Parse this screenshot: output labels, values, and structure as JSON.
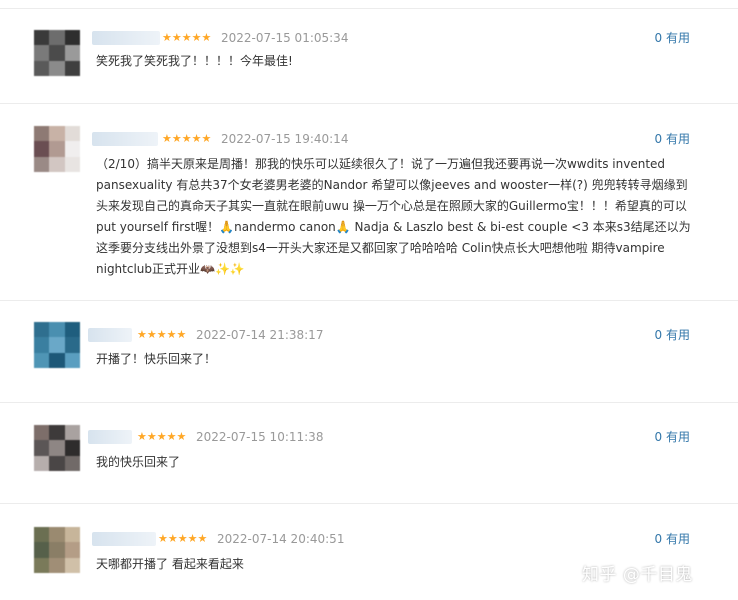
{
  "reviews": [
    {
      "stars": "★★★★★",
      "time": "2022-07-15 01:05:34",
      "useful": "0 有用",
      "text": "笑死我了笑死我了！！！！今年最佳!",
      "avatar": [
        "#3a3a3a",
        "#6d6d6d",
        "#2e2e2e",
        "#7a7a7a",
        "#4b4b4b",
        "#9a9a9a",
        "#5a5a5a",
        "#8b8b8b",
        "#3f3f3f"
      ]
    },
    {
      "stars": "★★★★★",
      "time": "2022-07-15 19:40:14",
      "useful": "0 有用",
      "text": "（2/10）搞半天原来是周播！那我的快乐可以延续很久了！说了一万遍但我还要再说一次wwdits invented pansexuality 有总共37个女老婆男老婆的Nandor 希望可以像jeeves and wooster一样(?) 兜兜转转寻烟缘到头来发现自己的真命天子其实一直就在眼前uwu 操一万个心总是在照顾大家的Guillermo宝！！！希望真的可以put yourself first喔！🙏nandermo canon🙏 Nadja & Laszlo best & bi-est couple <3 本来s3结尾还以为这季要分支线出外景了没想到s4一开头大家还是又都回家了哈哈哈哈 Colin快点长大吧想他啦 期待vampire nightclub正式开业🦇✨✨",
      "avatar": [
        "#8e7a74",
        "#c8b2a6",
        "#e2dcd8",
        "#6a4e52",
        "#b19a92",
        "#f0eeee",
        "#9a8a86",
        "#d2c6c2",
        "#e8e4e2"
      ]
    },
    {
      "stars": "★★★★★",
      "time": "2022-07-14 21:38:17",
      "useful": "0 有用",
      "text": "开播了！快乐回来了！",
      "avatar": [
        "#2f6f8f",
        "#4a8fb0",
        "#1f5e7e",
        "#3a7fa0",
        "#6aa8c8",
        "#2a6a8a",
        "#4f95b5",
        "#1d5878",
        "#5a9ec0"
      ]
    },
    {
      "stars": "★★★★★",
      "time": "2022-07-15 10:11:38",
      "useful": "0 有用",
      "text": "我的快乐回来了",
      "avatar": [
        "#7d6e6a",
        "#3d3a3a",
        "#a9a2a0",
        "#5b5656",
        "#8e8684",
        "#2e2c2c",
        "#b6aeac",
        "#4a4646",
        "#716a68"
      ]
    },
    {
      "stars": "★★★★★",
      "time": "2022-07-14 20:40:51",
      "useful": "0 有用",
      "text": "天哪都开播了 看起来看起来",
      "avatar": [
        "#6b6f52",
        "#9a8a70",
        "#c7b59a",
        "#56604a",
        "#8a7e66",
        "#b49d86",
        "#7a7a5a",
        "#a08e76",
        "#d0c0a8"
      ]
    }
  ],
  "watermark": "知乎 @千目鬼"
}
